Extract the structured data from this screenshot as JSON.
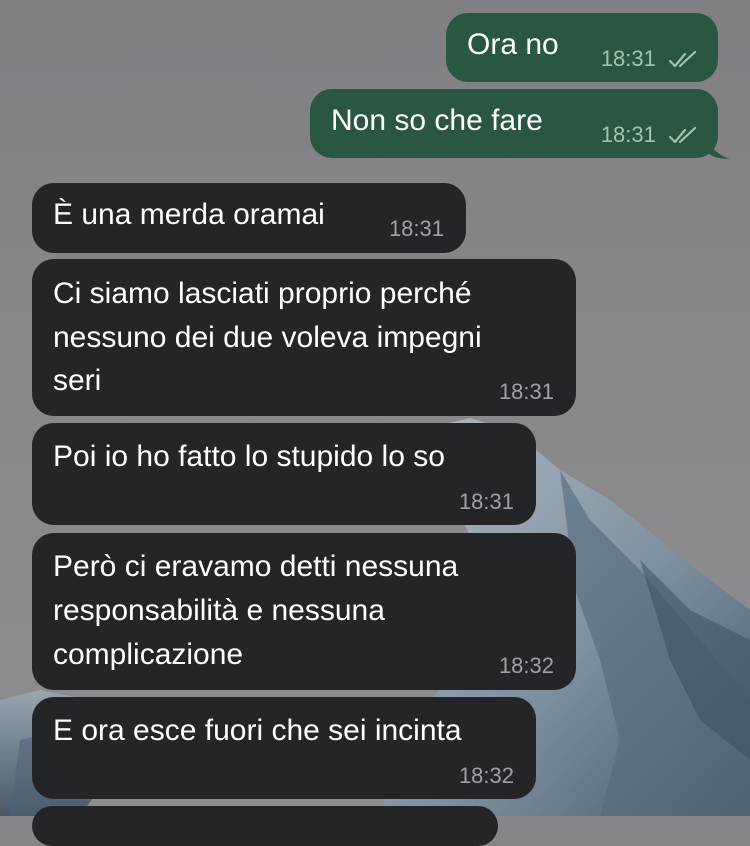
{
  "chat": {
    "outgoing": [
      {
        "text": "Ora no",
        "time": "18:31",
        "status_icon": "double-check-icon"
      },
      {
        "text": "Non so che fare",
        "time": "18:31",
        "status_icon": "double-check-icon"
      }
    ],
    "incoming": [
      {
        "text": "È una merda oramai",
        "time": "18:31"
      },
      {
        "lines": [
          "Ci siamo lasciati proprio perché",
          "nessuno dei due voleva impegni",
          "seri"
        ],
        "time": "18:31"
      },
      {
        "text": "Poi io ho fatto lo stupido lo so",
        "time": "18:31"
      },
      {
        "lines": [
          "Però ci eravamo detti nessuna",
          "responsabilità e nessuna",
          "complicazione"
        ],
        "time": "18:32"
      },
      {
        "text": "E ora esce fuori che sei incinta",
        "time": "18:32"
      }
    ]
  },
  "colors": {
    "incoming_bubble": "#242528",
    "outgoing_bubble": "#2a5741",
    "timestamp_incoming": "#a0a1a6",
    "timestamp_outgoing": "#9fc4af"
  }
}
